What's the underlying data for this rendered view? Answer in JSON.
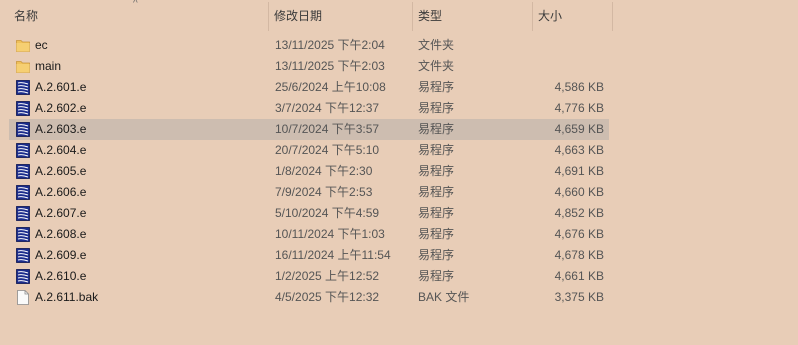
{
  "columns": {
    "name": "名称",
    "date": "修改日期",
    "type": "类型",
    "size": "大小"
  },
  "sort_indicator": "^",
  "files": [
    {
      "name": "ec",
      "date": "13/11/2025 下午2:04",
      "type": "文件夹",
      "size": "",
      "icon": "folder-icon",
      "selected": false
    },
    {
      "name": "main",
      "date": "13/11/2025 下午2:03",
      "type": "文件夹",
      "size": "",
      "icon": "folder-icon",
      "selected": false
    },
    {
      "name": "A.2.601.e",
      "date": "25/6/2024 上午10:08",
      "type": "易程序",
      "size": "4,586 KB",
      "icon": "e-program-icon",
      "selected": false
    },
    {
      "name": "A.2.602.e",
      "date": "3/7/2024 下午12:37",
      "type": "易程序",
      "size": "4,776 KB",
      "icon": "e-program-icon",
      "selected": false
    },
    {
      "name": "A.2.603.e",
      "date": "10/7/2024 下午3:57",
      "type": "易程序",
      "size": "4,659 KB",
      "icon": "e-program-icon",
      "selected": true
    },
    {
      "name": "A.2.604.e",
      "date": "20/7/2024 下午5:10",
      "type": "易程序",
      "size": "4,663 KB",
      "icon": "e-program-icon",
      "selected": false
    },
    {
      "name": "A.2.605.e",
      "date": "1/8/2024 下午2:30",
      "type": "易程序",
      "size": "4,691 KB",
      "icon": "e-program-icon",
      "selected": false
    },
    {
      "name": "A.2.606.e",
      "date": "7/9/2024 下午2:53",
      "type": "易程序",
      "size": "4,660 KB",
      "icon": "e-program-icon",
      "selected": false
    },
    {
      "name": "A.2.607.e",
      "date": "5/10/2024 下午4:59",
      "type": "易程序",
      "size": "4,852 KB",
      "icon": "e-program-icon",
      "selected": false
    },
    {
      "name": "A.2.608.e",
      "date": "10/11/2024 下午1:03",
      "type": "易程序",
      "size": "4,676 KB",
      "icon": "e-program-icon",
      "selected": false
    },
    {
      "name": "A.2.609.e",
      "date": "16/11/2024 上午11:54",
      "type": "易程序",
      "size": "4,678 KB",
      "icon": "e-program-icon",
      "selected": false
    },
    {
      "name": "A.2.610.e",
      "date": "1/2/2025 上午12:52",
      "type": "易程序",
      "size": "4,661 KB",
      "icon": "e-program-icon",
      "selected": false
    },
    {
      "name": "A.2.611.bak",
      "date": "4/5/2025 下午12:32",
      "type": "BAK 文件",
      "size": "3,375 KB",
      "icon": "generic-file-icon",
      "selected": false
    }
  ],
  "colors": {
    "background": "#e8cdb7",
    "selected_row": "#cdbdb0",
    "folder": "#f0c15a",
    "e_program": "#1a2c8c"
  }
}
